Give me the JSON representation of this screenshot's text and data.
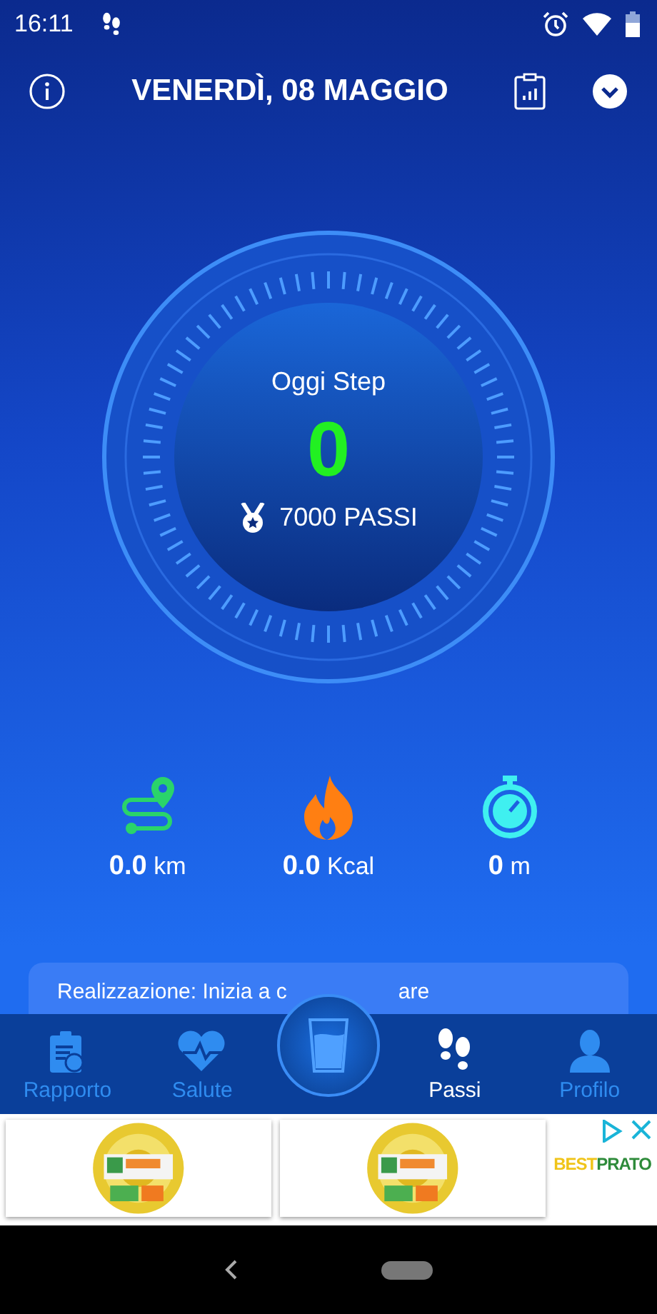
{
  "status_bar": {
    "time": "16:11"
  },
  "header": {
    "title": "VENERDÌ, 08 MAGGIO"
  },
  "dial": {
    "label": "Oggi Step",
    "value": "0",
    "goal": "7000 PASSI"
  },
  "stats": [
    {
      "kind": "distance",
      "value": "0.0",
      "unit": "km"
    },
    {
      "kind": "calories",
      "value": "0.0",
      "unit": "Kcal"
    },
    {
      "kind": "duration",
      "value": "0",
      "unit": "m"
    }
  ],
  "card": {
    "text_start": "Realizzazione: Inizia a c",
    "text_end": "are"
  },
  "nav": [
    {
      "kind": "report",
      "label": "Rapporto",
      "selected": false
    },
    {
      "kind": "health",
      "label": "Salute",
      "selected": false
    },
    {
      "kind": "water",
      "selected": false
    },
    {
      "kind": "steps",
      "label": "Passi",
      "selected": true
    },
    {
      "kind": "profile",
      "label": "Profilo",
      "selected": false
    }
  ],
  "ad": {
    "brand": [
      {
        "text": "BEST",
        "color": "#f0c419"
      },
      {
        "text": "PRATO",
        "color": "#2e8b3a"
      }
    ]
  }
}
